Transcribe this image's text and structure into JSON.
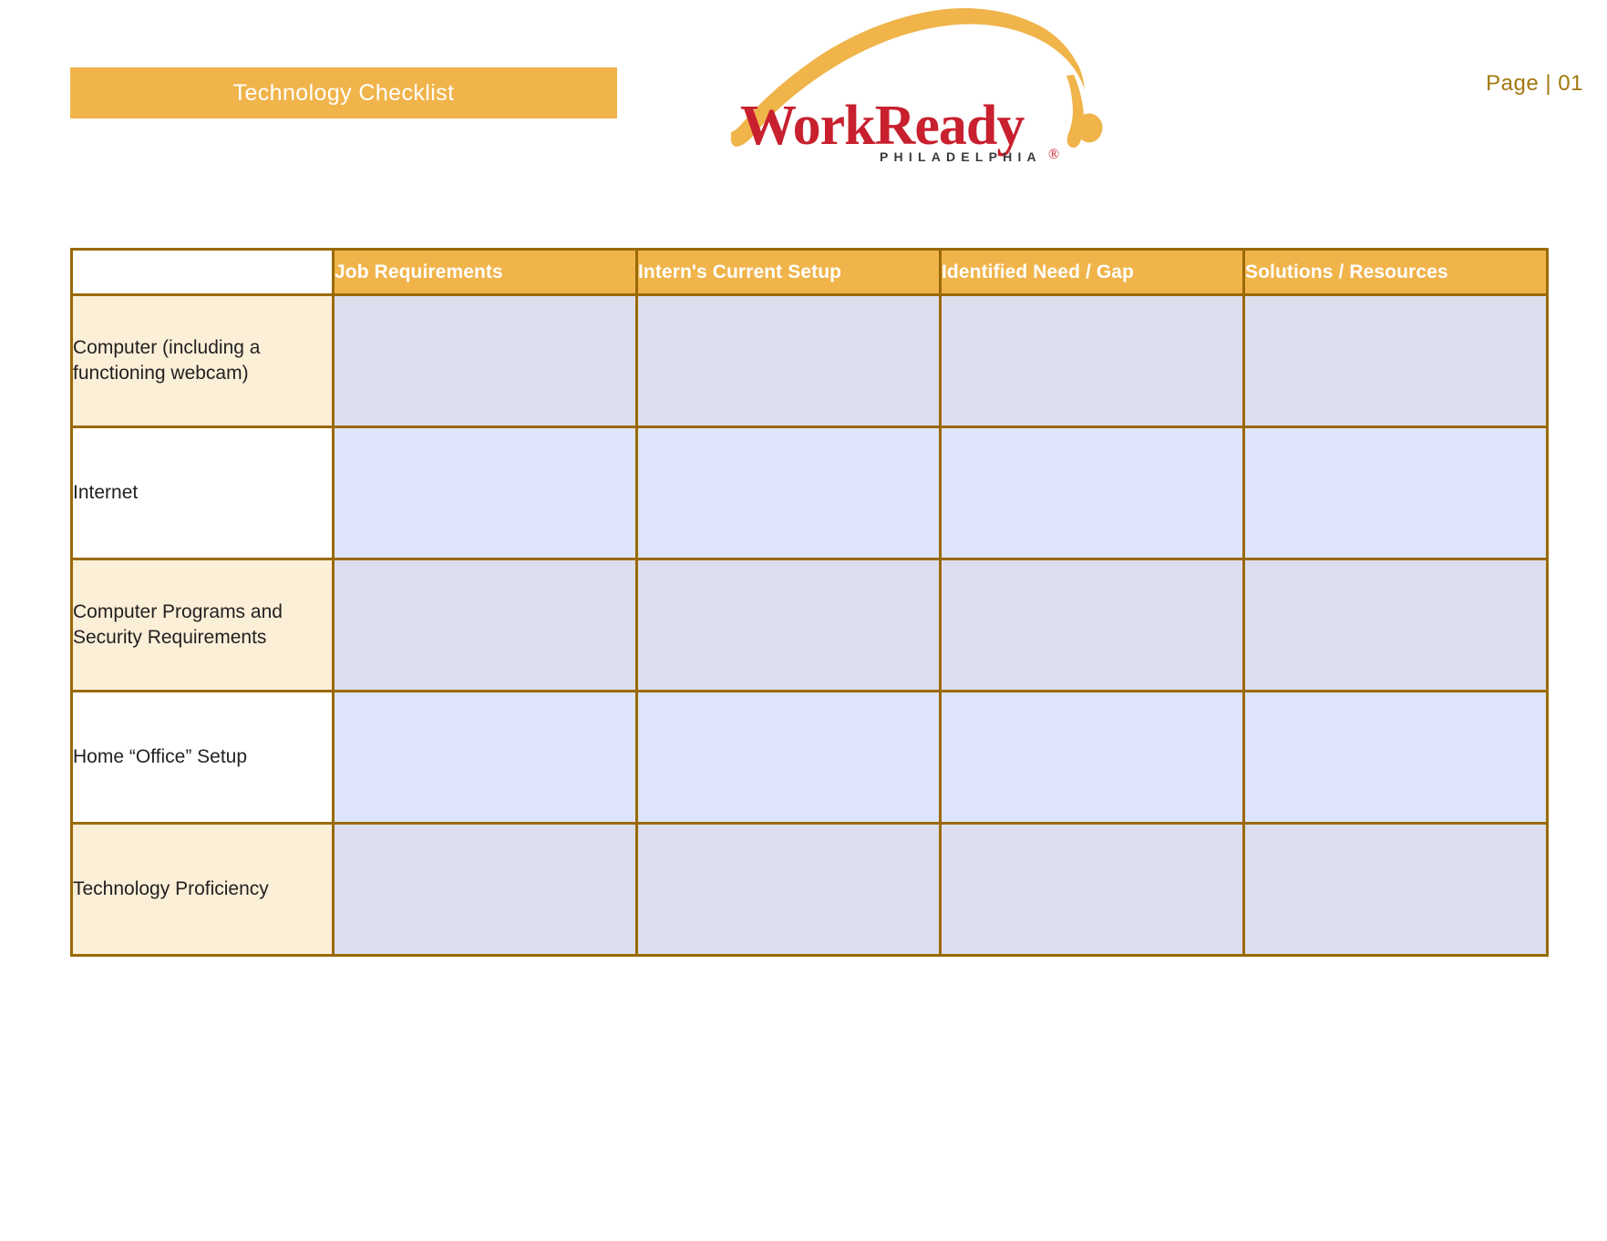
{
  "header": {
    "banner_title": "Technology Checklist",
    "page_label": "Page  |  01",
    "logo": {
      "wordmark": "WorkReady",
      "tagline": "PHILADELPHIA",
      "registered_mark": "®",
      "swoosh_color": "#F0B44B",
      "wordmark_color": "#C8202E",
      "tagline_color": "#3A3A3A"
    }
  },
  "colors": {
    "accent_gold": "#F0B44B",
    "border_brown": "#9A6A06",
    "label_tint": "#FBEFD8",
    "entry_tint": "#DCDEEE",
    "entry_plain": "#DDE4FC",
    "page_number_text": "#A2780E"
  },
  "table": {
    "corner_header": "",
    "columns": [
      "Job Requirements",
      "Intern's Current Setup",
      "Identified Need / Gap",
      "Solutions / Resources"
    ],
    "rows": [
      {
        "label": "Computer (including a functioning webcam)",
        "cells": [
          "",
          "",
          "",
          ""
        ]
      },
      {
        "label": "Internet",
        "cells": [
          "",
          "",
          "",
          ""
        ]
      },
      {
        "label": "Computer Programs and Security Requirements",
        "cells": [
          "",
          "",
          "",
          ""
        ]
      },
      {
        "label": "Home “Office” Setup",
        "cells": [
          "",
          "",
          "",
          ""
        ]
      },
      {
        "label": "Technology Proficiency",
        "cells": [
          "",
          "",
          "",
          ""
        ]
      }
    ]
  }
}
